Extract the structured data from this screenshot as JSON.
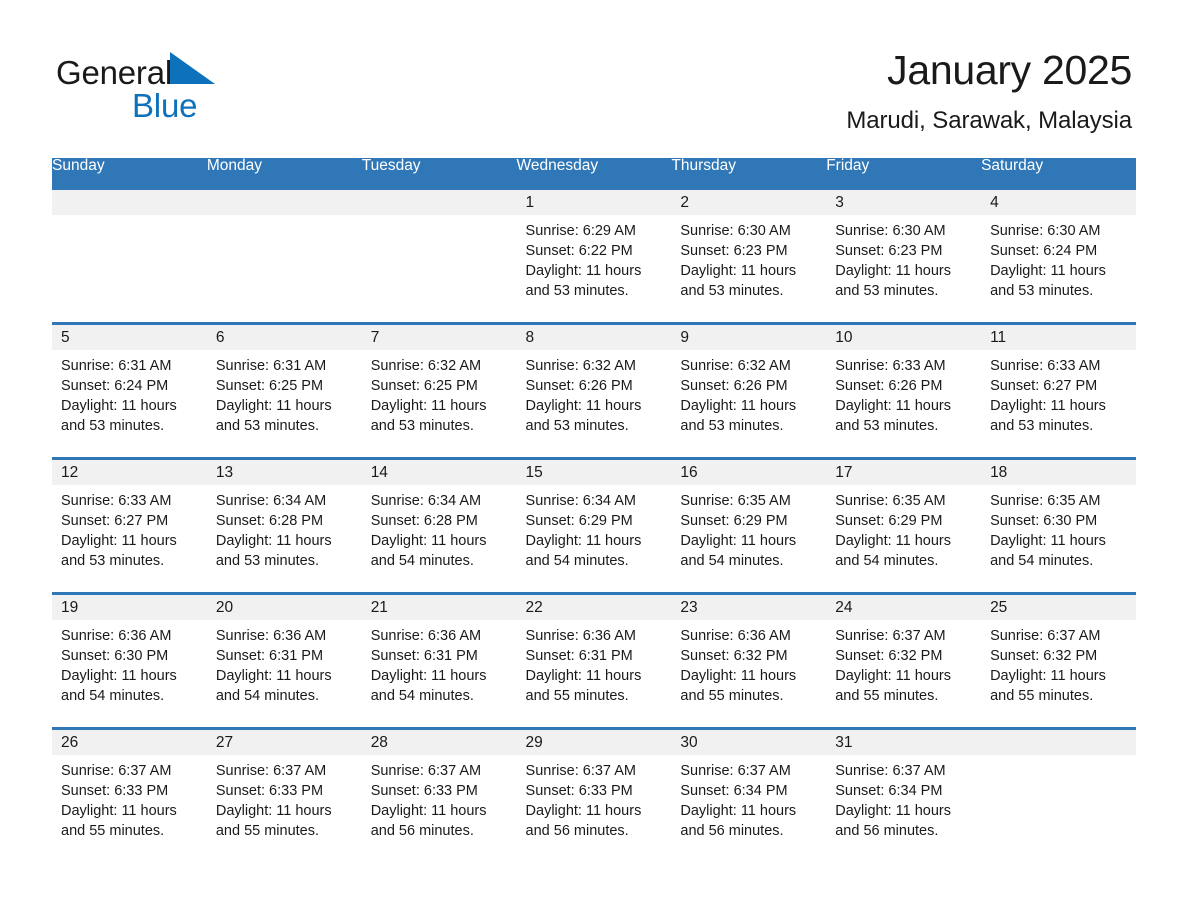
{
  "brand": {
    "word_general": "General",
    "word_blue": "Blue",
    "triangle_color": "#0d72bb"
  },
  "header": {
    "title": "January 2025",
    "subtitle": "Marudi, Sarawak, Malaysia"
  },
  "theme": {
    "header_blue": "#2f77b6",
    "daynum_band": "#f1f1f1",
    "text": "#1a1a1a"
  },
  "weekdays": [
    "Sunday",
    "Monday",
    "Tuesday",
    "Wednesday",
    "Thursday",
    "Friday",
    "Saturday"
  ],
  "weeks": [
    [
      {
        "day": "",
        "blank": true
      },
      {
        "day": "",
        "blank": true
      },
      {
        "day": "",
        "blank": true
      },
      {
        "day": "1",
        "sunrise": "Sunrise: 6:29 AM",
        "sunset": "Sunset: 6:22 PM",
        "daylight": "Daylight: 11 hours and 53 minutes."
      },
      {
        "day": "2",
        "sunrise": "Sunrise: 6:30 AM",
        "sunset": "Sunset: 6:23 PM",
        "daylight": "Daylight: 11 hours and 53 minutes."
      },
      {
        "day": "3",
        "sunrise": "Sunrise: 6:30 AM",
        "sunset": "Sunset: 6:23 PM",
        "daylight": "Daylight: 11 hours and 53 minutes."
      },
      {
        "day": "4",
        "sunrise": "Sunrise: 6:30 AM",
        "sunset": "Sunset: 6:24 PM",
        "daylight": "Daylight: 11 hours and 53 minutes."
      }
    ],
    [
      {
        "day": "5",
        "sunrise": "Sunrise: 6:31 AM",
        "sunset": "Sunset: 6:24 PM",
        "daylight": "Daylight: 11 hours and 53 minutes."
      },
      {
        "day": "6",
        "sunrise": "Sunrise: 6:31 AM",
        "sunset": "Sunset: 6:25 PM",
        "daylight": "Daylight: 11 hours and 53 minutes."
      },
      {
        "day": "7",
        "sunrise": "Sunrise: 6:32 AM",
        "sunset": "Sunset: 6:25 PM",
        "daylight": "Daylight: 11 hours and 53 minutes."
      },
      {
        "day": "8",
        "sunrise": "Sunrise: 6:32 AM",
        "sunset": "Sunset: 6:26 PM",
        "daylight": "Daylight: 11 hours and 53 minutes."
      },
      {
        "day": "9",
        "sunrise": "Sunrise: 6:32 AM",
        "sunset": "Sunset: 6:26 PM",
        "daylight": "Daylight: 11 hours and 53 minutes."
      },
      {
        "day": "10",
        "sunrise": "Sunrise: 6:33 AM",
        "sunset": "Sunset: 6:26 PM",
        "daylight": "Daylight: 11 hours and 53 minutes."
      },
      {
        "day": "11",
        "sunrise": "Sunrise: 6:33 AM",
        "sunset": "Sunset: 6:27 PM",
        "daylight": "Daylight: 11 hours and 53 minutes."
      }
    ],
    [
      {
        "day": "12",
        "sunrise": "Sunrise: 6:33 AM",
        "sunset": "Sunset: 6:27 PM",
        "daylight": "Daylight: 11 hours and 53 minutes."
      },
      {
        "day": "13",
        "sunrise": "Sunrise: 6:34 AM",
        "sunset": "Sunset: 6:28 PM",
        "daylight": "Daylight: 11 hours and 53 minutes."
      },
      {
        "day": "14",
        "sunrise": "Sunrise: 6:34 AM",
        "sunset": "Sunset: 6:28 PM",
        "daylight": "Daylight: 11 hours and 54 minutes."
      },
      {
        "day": "15",
        "sunrise": "Sunrise: 6:34 AM",
        "sunset": "Sunset: 6:29 PM",
        "daylight": "Daylight: 11 hours and 54 minutes."
      },
      {
        "day": "16",
        "sunrise": "Sunrise: 6:35 AM",
        "sunset": "Sunset: 6:29 PM",
        "daylight": "Daylight: 11 hours and 54 minutes."
      },
      {
        "day": "17",
        "sunrise": "Sunrise: 6:35 AM",
        "sunset": "Sunset: 6:29 PM",
        "daylight": "Daylight: 11 hours and 54 minutes."
      },
      {
        "day": "18",
        "sunrise": "Sunrise: 6:35 AM",
        "sunset": "Sunset: 6:30 PM",
        "daylight": "Daylight: 11 hours and 54 minutes."
      }
    ],
    [
      {
        "day": "19",
        "sunrise": "Sunrise: 6:36 AM",
        "sunset": "Sunset: 6:30 PM",
        "daylight": "Daylight: 11 hours and 54 minutes."
      },
      {
        "day": "20",
        "sunrise": "Sunrise: 6:36 AM",
        "sunset": "Sunset: 6:31 PM",
        "daylight": "Daylight: 11 hours and 54 minutes."
      },
      {
        "day": "21",
        "sunrise": "Sunrise: 6:36 AM",
        "sunset": "Sunset: 6:31 PM",
        "daylight": "Daylight: 11 hours and 54 minutes."
      },
      {
        "day": "22",
        "sunrise": "Sunrise: 6:36 AM",
        "sunset": "Sunset: 6:31 PM",
        "daylight": "Daylight: 11 hours and 55 minutes."
      },
      {
        "day": "23",
        "sunrise": "Sunrise: 6:36 AM",
        "sunset": "Sunset: 6:32 PM",
        "daylight": "Daylight: 11 hours and 55 minutes."
      },
      {
        "day": "24",
        "sunrise": "Sunrise: 6:37 AM",
        "sunset": "Sunset: 6:32 PM",
        "daylight": "Daylight: 11 hours and 55 minutes."
      },
      {
        "day": "25",
        "sunrise": "Sunrise: 6:37 AM",
        "sunset": "Sunset: 6:32 PM",
        "daylight": "Daylight: 11 hours and 55 minutes."
      }
    ],
    [
      {
        "day": "26",
        "sunrise": "Sunrise: 6:37 AM",
        "sunset": "Sunset: 6:33 PM",
        "daylight": "Daylight: 11 hours and 55 minutes."
      },
      {
        "day": "27",
        "sunrise": "Sunrise: 6:37 AM",
        "sunset": "Sunset: 6:33 PM",
        "daylight": "Daylight: 11 hours and 55 minutes."
      },
      {
        "day": "28",
        "sunrise": "Sunrise: 6:37 AM",
        "sunset": "Sunset: 6:33 PM",
        "daylight": "Daylight: 11 hours and 56 minutes."
      },
      {
        "day": "29",
        "sunrise": "Sunrise: 6:37 AM",
        "sunset": "Sunset: 6:33 PM",
        "daylight": "Daylight: 11 hours and 56 minutes."
      },
      {
        "day": "30",
        "sunrise": "Sunrise: 6:37 AM",
        "sunset": "Sunset: 6:34 PM",
        "daylight": "Daylight: 11 hours and 56 minutes."
      },
      {
        "day": "31",
        "sunrise": "Sunrise: 6:37 AM",
        "sunset": "Sunset: 6:34 PM",
        "daylight": "Daylight: 11 hours and 56 minutes."
      },
      {
        "day": "",
        "blank": true
      }
    ]
  ]
}
